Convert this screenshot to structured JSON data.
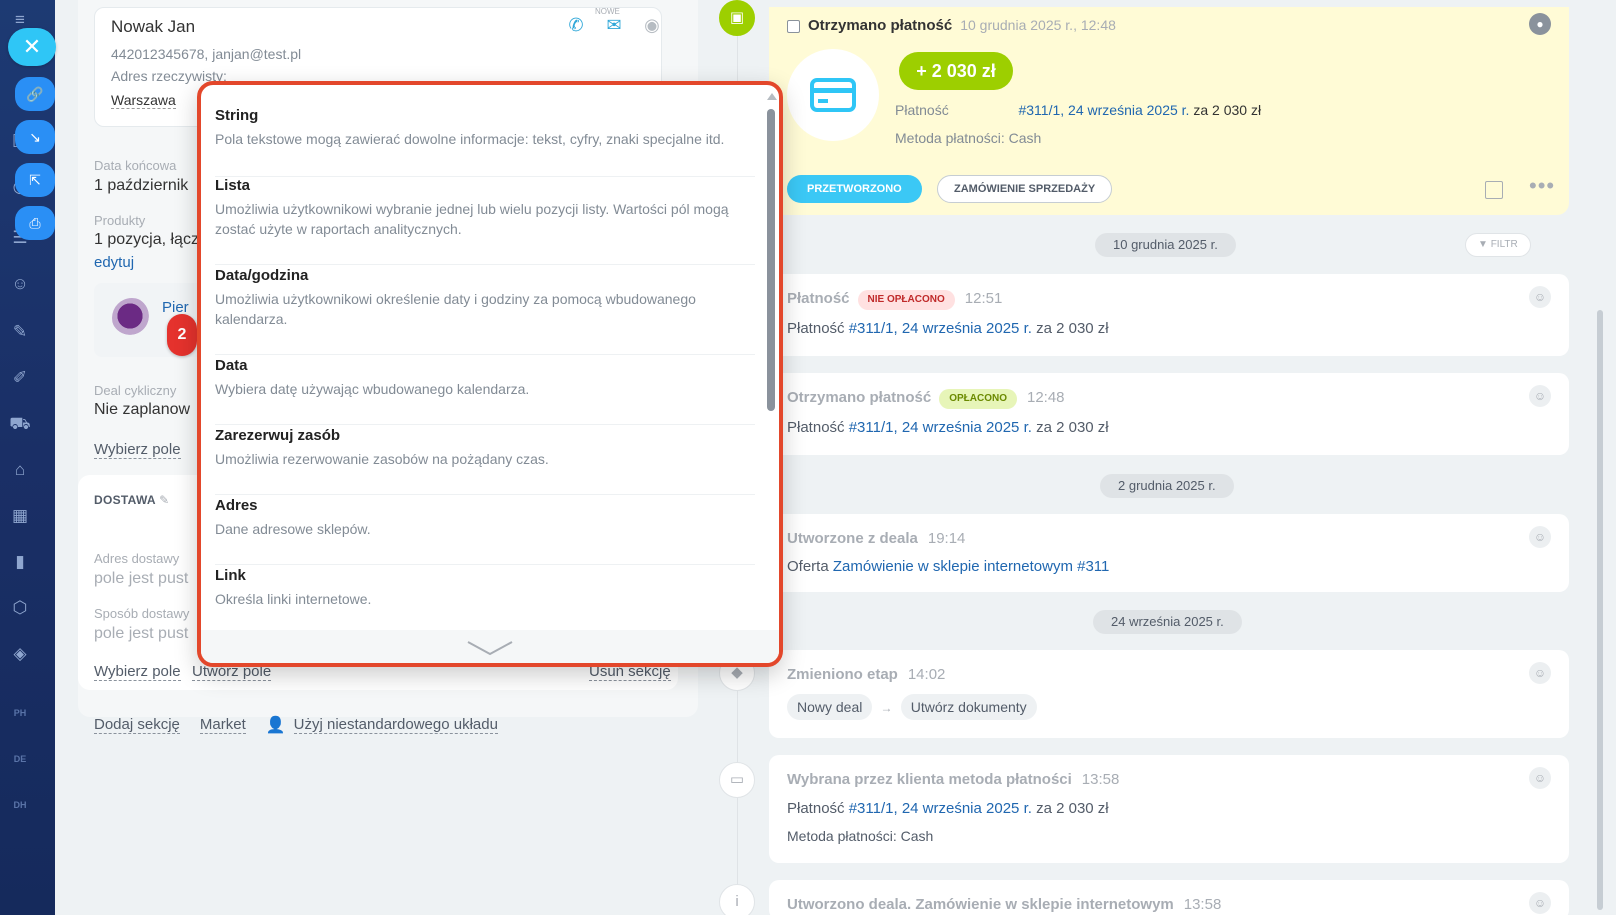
{
  "app_sidebar": {
    "icons": [
      "menu-icon",
      "link-icon",
      "image-icon",
      "target-icon",
      "filter-icon",
      "robot-icon",
      "edit-icon",
      "doc-edit-icon",
      "cart-icon",
      "warehouse-icon",
      "calendar-icon",
      "chart-icon",
      "shield-icon",
      "box-icon"
    ],
    "text_badges": [
      "PH",
      "DE",
      "DH"
    ]
  },
  "side_actions": [
    "close-icon",
    "link-icon",
    "download-icon",
    "open-icon",
    "print-icon"
  ],
  "client": {
    "name": "Nowak Jan",
    "contact": "442012345678, janjan@test.pl",
    "address_label": "Adres rzeczywisty:",
    "city": "Warszawa",
    "new_badge": "NOWE"
  },
  "fields": {
    "end_date_label": "Data końcowa",
    "end_date_value": "1 październik",
    "products_label": "Produkty",
    "products_value": "1 pozycja, łącz",
    "edit_link": "edytuj",
    "product_link": "Pier",
    "recurring_label": "Deal cykliczny",
    "recurring_value": "Nie zaplanow",
    "select_field": "Wybierz pole"
  },
  "badge_number": "2",
  "delivery": {
    "title": "DOSTAWA",
    "address_label": "Adres dostawy",
    "address_value": "pole jest pust",
    "method_label": "Sposób dostawy",
    "method_value": "pole jest pust",
    "select_field": "Wybierz pole",
    "create_field": "Utwórz pole",
    "delete_section": "Usuń sekcję"
  },
  "bottom_links": {
    "add_section": "Dodaj sekcję",
    "market": "Market",
    "custom_layout": "Użyj niestandardowego układu"
  },
  "popup": {
    "items": [
      {
        "title": "String",
        "desc": "Pola tekstowe mogą zawierać dowolne informacje: tekst, cyfry, znaki specjalne itd."
      },
      {
        "title": "Lista",
        "desc": "Umożliwia użytkownikowi wybranie jednej lub wielu pozycji listy. Wartości pól mogą zostać użyte w raportach analitycznych."
      },
      {
        "title": "Data/godzina",
        "desc": "Umożliwia użytkownikowi określenie daty i godziny za pomocą wbudowanego kalendarza."
      },
      {
        "title": "Data",
        "desc": "Wybiera datę używając wbudowanego kalendarza."
      },
      {
        "title": "Zarezerwuj zasób",
        "desc": "Umożliwia rezerwowanie zasobów na pożądany czas."
      },
      {
        "title": "Adres",
        "desc": "Dane adresowe sklepów."
      },
      {
        "title": "Link",
        "desc": "Określa linki internetowe."
      }
    ]
  },
  "payment_card": {
    "title": "Otrzymano płatność",
    "date": "10 grudnia 2025 r., 12:48",
    "amount": "+ 2 030 zł",
    "payment_label": "Płatność",
    "payment_link": "#311/1, 24 września 2025 r.",
    "payment_suffix": "za 2 030 zł",
    "method": "Metoda płatności: Cash",
    "btn_processed": "PRZETWORZONO",
    "btn_sales_order": "ZAMÓWIENIE SPRZEDAŻY",
    "dots": "•••"
  },
  "timeline": {
    "filter": "FILTR",
    "dates": [
      "10 grudnia 2025 r.",
      "2 grudnia 2025 r.",
      "24 września 2025 r."
    ],
    "entries": [
      {
        "title": "Płatność",
        "tag": "NIE OPŁACONO",
        "time": "12:51",
        "prefix": "Płatność",
        "link": "#311/1, 24 września 2025 r.",
        "suffix": "za 2 030 zł"
      },
      {
        "title": "Otrzymano płatność",
        "tag": "OPŁACONO",
        "time": "12:48",
        "prefix": "Płatność",
        "link": "#311/1, 24 września 2025 r.",
        "suffix": "za 2 030 zł"
      },
      {
        "title": "Utworzone z deala",
        "time": "19:14",
        "prefix": "Oferta",
        "link": "Zamówienie w sklepie internetowym #311"
      },
      {
        "title": "Zmieniono etap",
        "time": "14:02",
        "stage_from": "Nowy deal",
        "arrow": "→",
        "stage_to": "Utwórz dokumenty"
      },
      {
        "title": "Wybrana przez klienta metoda płatności",
        "time": "13:58",
        "prefix": "Płatność",
        "link": "#311/1, 24 września 2025 r.",
        "suffix": "za 2 030 zł",
        "method": "Metoda płatności: Cash"
      },
      {
        "title": "Utworzono deala. Zamówienie w sklepie internetowym",
        "time": "13:58"
      }
    ]
  }
}
